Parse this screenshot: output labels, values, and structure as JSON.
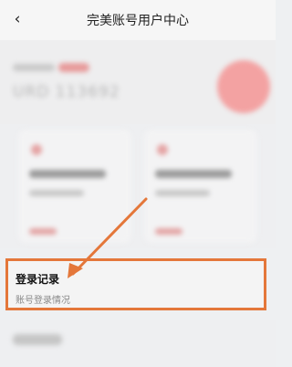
{
  "header": {
    "back_icon": "‹",
    "title": "完美账号用户中心"
  },
  "login_record": {
    "title": "登录记录",
    "subtitle": "账号登录情况"
  },
  "colors": {
    "highlight_border": "#e4773a",
    "arrow": "#e4773a",
    "accent": "#e79a9a"
  }
}
